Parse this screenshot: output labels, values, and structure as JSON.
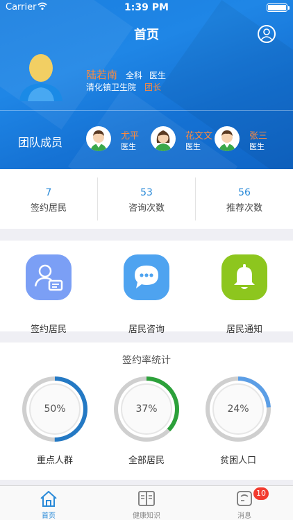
{
  "status_bar": {
    "carrier": "Carrier",
    "time": "1:39 PM"
  },
  "nav": {
    "title": "首页",
    "profile_icon": "user-circle-icon"
  },
  "doctor": {
    "name": "陆若南",
    "department": "全科",
    "title": "医生",
    "hospital": "清化镇卫生院",
    "role": "团长"
  },
  "team": {
    "label": "团队成员",
    "members": [
      {
        "name": "尤平",
        "role": "医生",
        "gender": "male"
      },
      {
        "name": "花文文",
        "role": "医生",
        "gender": "female"
      },
      {
        "name": "张三",
        "role": "医生",
        "gender": "male"
      }
    ]
  },
  "stats": [
    {
      "value": "7",
      "label": "签约居民"
    },
    {
      "value": "53",
      "label": "咨询次数"
    },
    {
      "value": "56",
      "label": "推荐次数"
    }
  ],
  "actions": [
    {
      "label": "签约居民",
      "icon": "resident-card-icon",
      "color": "#7b9ff5"
    },
    {
      "label": "居民咨询",
      "icon": "chat-bubble-icon",
      "color": "#4ea3f0"
    },
    {
      "label": "居民通知",
      "icon": "bell-icon",
      "color": "#8dc61e"
    }
  ],
  "rates": {
    "title": "签约率统计",
    "items": [
      {
        "label": "重点人群",
        "percent_text": "50%",
        "value": 0.5,
        "color": "#2479c4"
      },
      {
        "label": "全部居民",
        "percent_text": "37%",
        "value": 0.37,
        "color": "#2ca13a"
      },
      {
        "label": "贫困人口",
        "percent_text": "24%",
        "value": 0.24,
        "color": "#5b9ee6"
      }
    ]
  },
  "tabbar": {
    "tabs": [
      {
        "label": "首页",
        "icon": "home-icon",
        "active": true
      },
      {
        "label": "健康知识",
        "icon": "book-icon",
        "active": false
      },
      {
        "label": "消息",
        "icon": "message-icon",
        "active": false,
        "badge": "10"
      }
    ]
  },
  "colors": {
    "primary": "#1f86e6",
    "accent": "#ff8a3d",
    "link": "#2a8ad8"
  }
}
